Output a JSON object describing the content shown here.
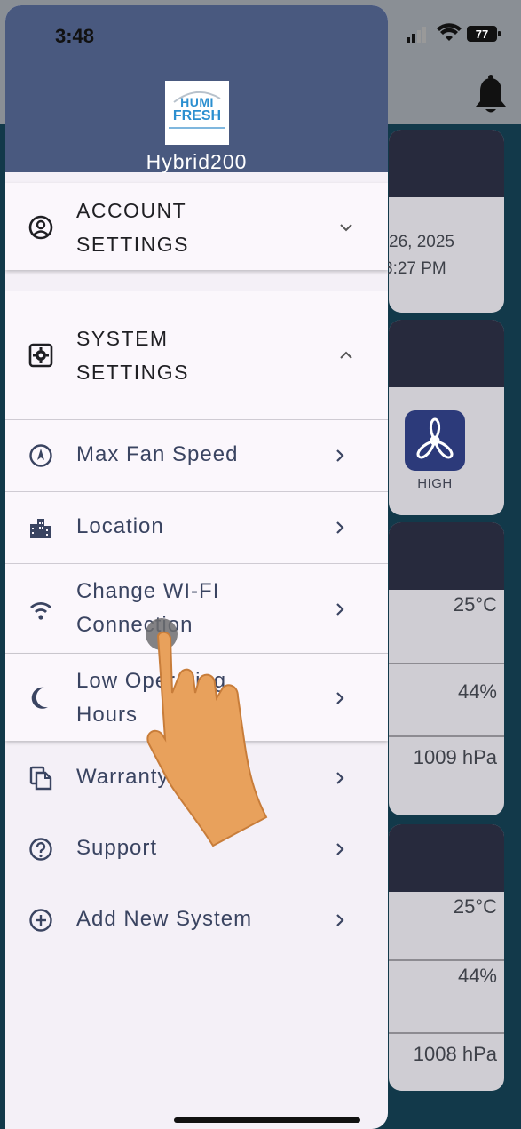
{
  "status_bar": {
    "time": "3:48",
    "battery": "77"
  },
  "drawer": {
    "device_name": "Hybrid200",
    "logo": {
      "line1": "HUMI",
      "line2": "FRESH"
    },
    "account_settings": {
      "title": "ACCOUNT\nSETTINGS",
      "icon": "account-circle-icon",
      "state": "collapsed"
    },
    "system_settings": {
      "title": "SYSTEM\nSETTINGS",
      "icon": "settings-box-icon",
      "state": "expanded",
      "items": [
        {
          "label": "Max Fan Speed",
          "icon": "speedometer-icon"
        },
        {
          "label": "Location",
          "icon": "city-icon"
        },
        {
          "label": "Change WI-FI\nConnection",
          "icon": "wifi-icon"
        },
        {
          "label": "Low Operating\nHours",
          "icon": "moon-icon"
        }
      ]
    },
    "menu_items": [
      {
        "label": "Warranty",
        "icon": "copy-document-icon"
      },
      {
        "label": "Support",
        "icon": "help-circle-icon"
      },
      {
        "label": "Add New System",
        "icon": "add-circle-icon"
      }
    ]
  },
  "background": {
    "date": "26, 2025",
    "time": "3:27 PM",
    "fan_mode": "HIGH",
    "readings_1": {
      "temperature": "25°C",
      "humidity": "44%",
      "pressure": "1009 hPa"
    },
    "readings_2": {
      "temperature": "25°C",
      "humidity": "44%",
      "pressure": "1008 hPa"
    }
  },
  "colors": {
    "drawer_header": "#49597f",
    "drawer_bg": "#f4f0f7",
    "item_text": "#3a4461",
    "accent_blue": "#2c3a7a"
  }
}
